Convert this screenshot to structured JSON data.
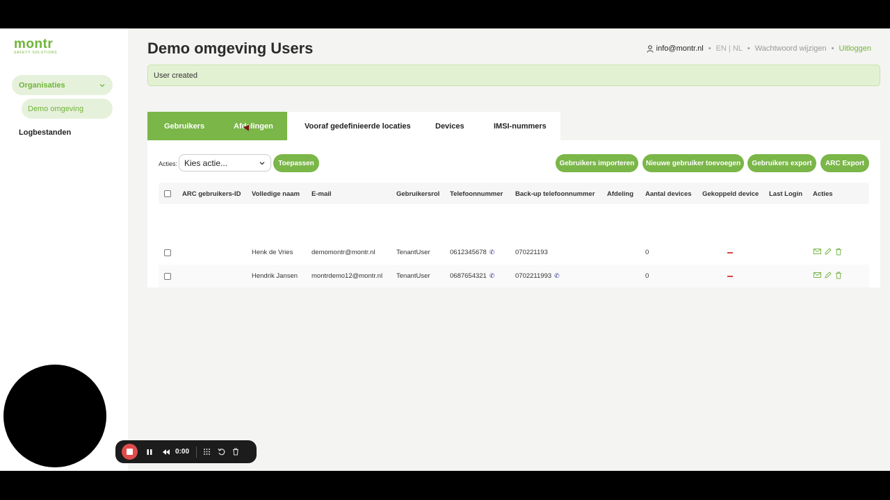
{
  "brand": {
    "logo": "montr",
    "logo_sub": "SAFETY SOLUTIONS",
    "accent": "#7ab648",
    "alert_bg": "#e3f1d3"
  },
  "sidebar": {
    "items": [
      {
        "label": "Organisaties",
        "icon": "chevron-down-icon"
      },
      {
        "label": "Demo omgeving"
      },
      {
        "label": "Logbestanden"
      }
    ]
  },
  "header": {
    "title": "Demo omgeving Users",
    "user_email": "info@montr.nl",
    "lang": "EN | NL",
    "change_password": "Wachtwoord wijzigen",
    "logout": "Uitloggen"
  },
  "alert": {
    "message": "User created"
  },
  "tabs": [
    {
      "label": "Gebruikers"
    },
    {
      "label": "Afdelingen"
    },
    {
      "label": "Vooraf gedefinieerde locaties"
    },
    {
      "label": "Devices"
    },
    {
      "label": "IMSI-nummers"
    }
  ],
  "toolbar": {
    "acties_label": "Acties:",
    "select_value": "Kies actie...",
    "apply": "Toepassen",
    "import": "Gebruikers importeren",
    "new_user": "Nieuwe gebruiker toevoegen",
    "export": "Gebruikers export",
    "arc_export": "ARC Export"
  },
  "table": {
    "columns": [
      "ARC gebruikers-ID",
      "Volledige naam",
      "E-mail",
      "Gebruikersrol",
      "Telefoonnummer",
      "Back-up telefoonnummer",
      "Afdeling",
      "Aantal devices",
      "Gekoppeld device",
      "Last Login",
      "Acties"
    ],
    "rows": [
      {
        "arc_id": "",
        "name": "Henk de Vries",
        "email": "demomontr@montr.nl",
        "role": "TenantUser",
        "phone": "0612345678",
        "backup_phone": "070221193",
        "department": "",
        "devices": "0",
        "last_login": ""
      },
      {
        "arc_id": "",
        "name": "Hendrik Jansen",
        "email": "montrdemo12@montr.nl",
        "role": "TenantUser",
        "phone": "0687654321",
        "backup_phone": "0702211993",
        "department": "",
        "devices": "0",
        "last_login": ""
      }
    ]
  },
  "recorder": {
    "time": "0:00"
  }
}
